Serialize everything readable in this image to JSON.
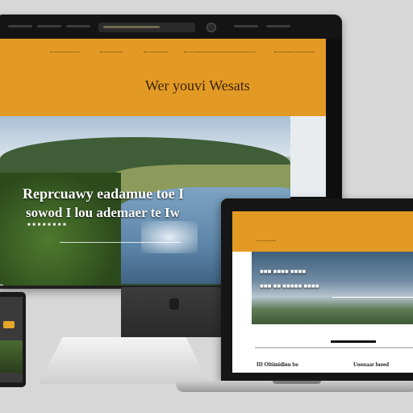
{
  "desktop": {
    "hero_title": "Wer youvi Wesats",
    "hero_line_1": "Reprcuawy eadamue toe I",
    "hero_line_2": "sowod I lou ademaer te Iw",
    "left_cut_text": "o"
  },
  "laptop": {
    "footer_left": "ID Oltimidinu bo",
    "footer_right": "Uoouaar luoed"
  },
  "colors": {
    "accent": "#e39a25",
    "bezel": "#101010",
    "background": "#d7d7d7"
  }
}
